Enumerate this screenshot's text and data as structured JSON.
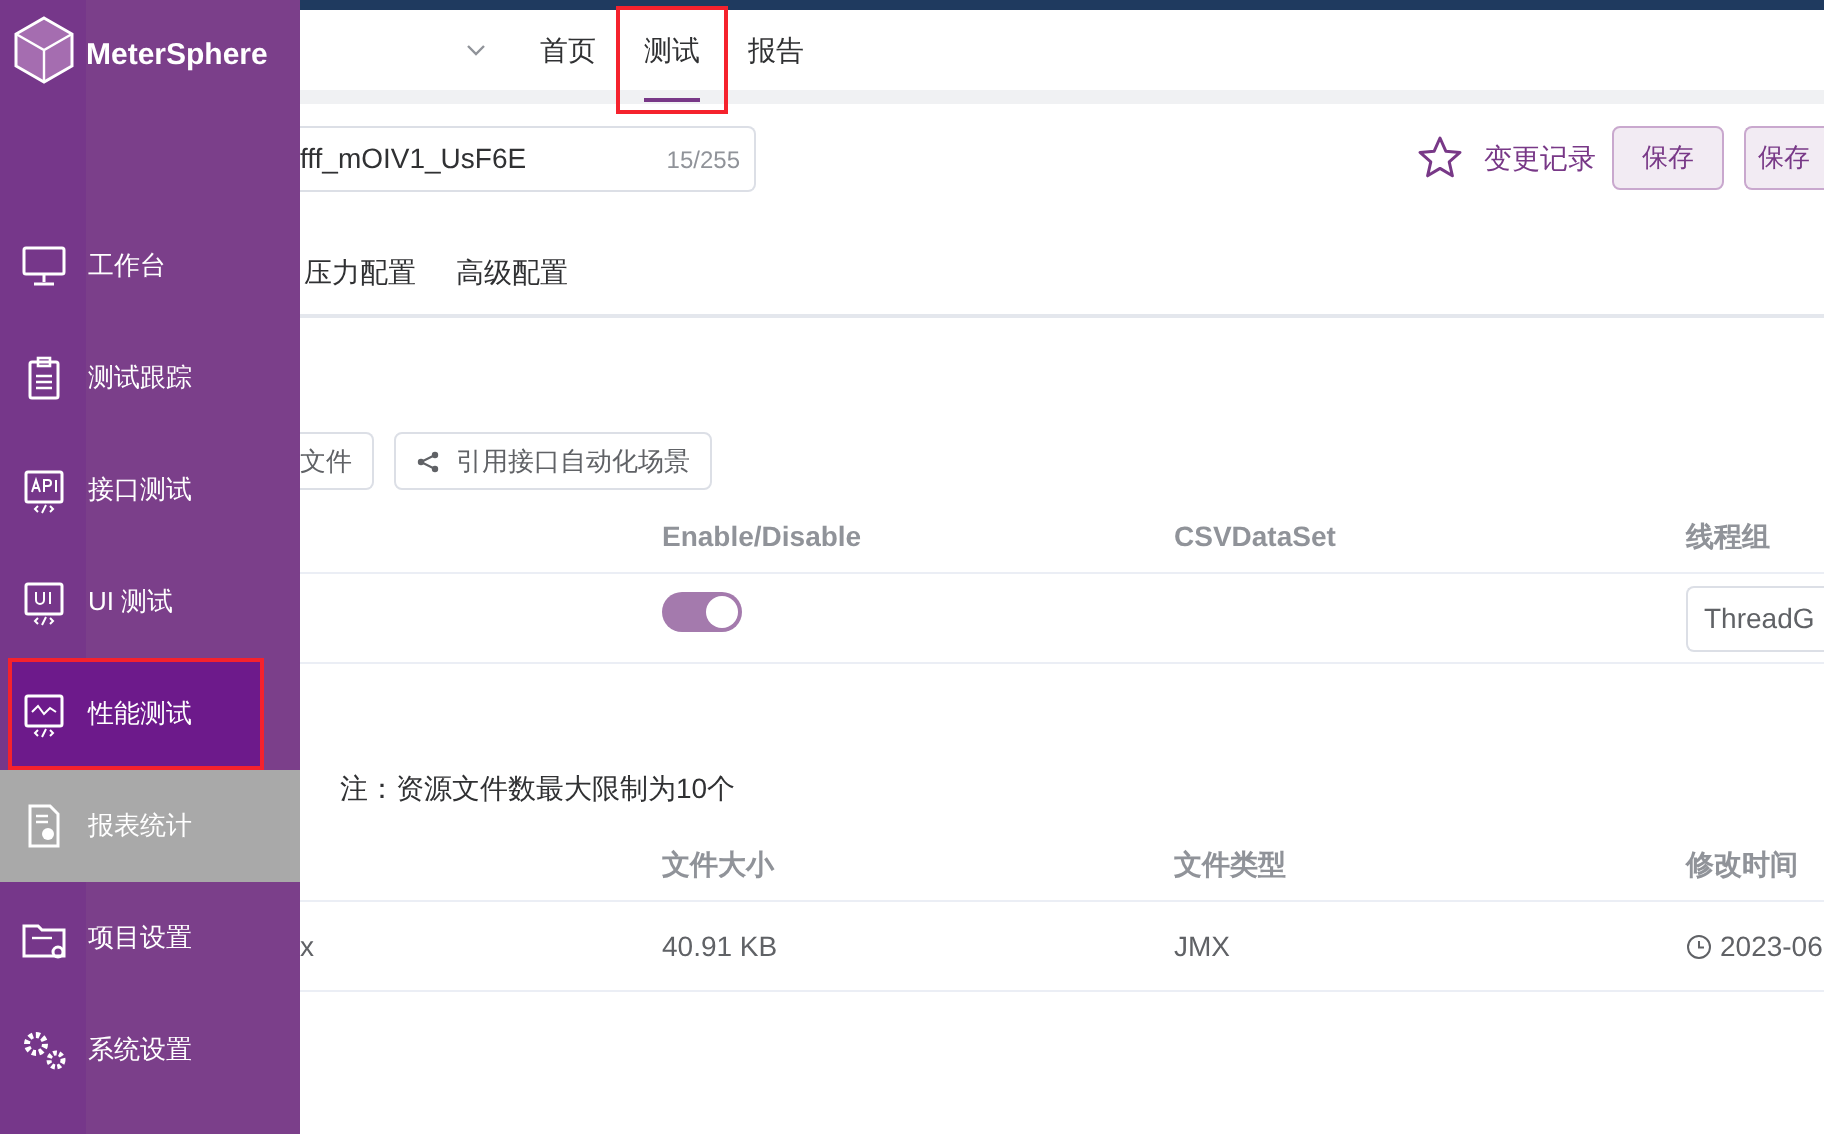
{
  "top_nav": {
    "tabs": [
      {
        "label": "首页",
        "selected": false,
        "highlighted": false
      },
      {
        "label": "测试",
        "selected": true,
        "highlighted": true
      },
      {
        "label": "报告",
        "selected": false,
        "highlighted": false
      }
    ]
  },
  "sidebar": {
    "logo": "MeterSphere",
    "items": [
      {
        "label": "工作台",
        "selected": false,
        "hovered": false,
        "highlighted": false
      },
      {
        "label": "测试跟踪",
        "selected": false,
        "hovered": false,
        "highlighted": false
      },
      {
        "label": "接口测试",
        "selected": false,
        "hovered": false,
        "highlighted": false
      },
      {
        "label": "UI 测试",
        "selected": false,
        "hovered": false,
        "highlighted": false
      },
      {
        "label": "性能测试",
        "selected": true,
        "hovered": false,
        "highlighted": true
      },
      {
        "label": "报表统计",
        "selected": false,
        "hovered": true,
        "highlighted": false
      },
      {
        "label": "项目设置",
        "selected": false,
        "hovered": false,
        "highlighted": false
      },
      {
        "label": "系统设置",
        "selected": false,
        "hovered": false,
        "highlighted": false
      }
    ]
  },
  "test_form": {
    "name_value": "fff_mOIV1_UsF6E",
    "name_counter": "15/255",
    "history_link": "变更记录",
    "buttons": [
      "保存",
      "保存"
    ]
  },
  "config_tabs": [
    {
      "label": "压力配置",
      "selected": false
    },
    {
      "label": "高级配置",
      "selected": false
    }
  ],
  "scenario_section": {
    "buttons": [
      {
        "label": "文件",
        "kind": "load"
      },
      {
        "label": "引用接口自动化场景",
        "kind": "reference"
      }
    ]
  },
  "scenario_table": {
    "columns": [
      "Enable/Disable",
      "CSVDataSet",
      "线程组"
    ],
    "rows": [
      {
        "enabled": true,
        "thread_group": "ThreadG"
      }
    ]
  },
  "resource_section": {
    "note": "注：资源文件数最大限制为10个"
  },
  "file_table": {
    "columns": [
      "文件大小",
      "文件类型",
      "修改时间"
    ],
    "rows": [
      {
        "name": "x",
        "size": "40.91 KB",
        "type": "JMX",
        "modified": "2023-06"
      }
    ]
  }
}
